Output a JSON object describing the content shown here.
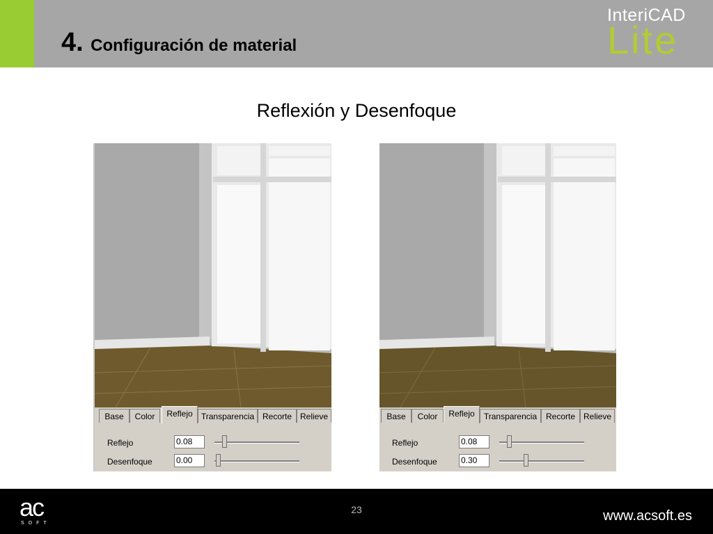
{
  "header": {
    "number": "4.",
    "title": "Configuración de material",
    "logo_top": "InteriCAD",
    "logo_bottom": "Lite",
    "accent_color": "#99cc33",
    "bar_color": "#a6a6a6"
  },
  "subtitle": "Reflexión y Desenfoque",
  "panels": [
    {
      "tabs": [
        "Base",
        "Color",
        "Reflejo",
        "Transparencia",
        "Recorte",
        "Relieve"
      ],
      "active_tab": "Reflejo",
      "reflejo_label": "Reflejo",
      "reflejo_value": "0.08",
      "desenfoque_label": "Desenfoque",
      "desenfoque_value": "0.00"
    },
    {
      "tabs": [
        "Base",
        "Color",
        "Reflejo",
        "Transparencia",
        "Recorte",
        "Relieve"
      ],
      "active_tab": "Reflejo",
      "reflejo_label": "Reflejo",
      "reflejo_value": "0.08",
      "desenfoque_label": "Desenfoque",
      "desenfoque_value": "0.30"
    }
  ],
  "footer": {
    "logo_letters": "ac",
    "logo_sub": "SOFT",
    "page_number": "23",
    "website": "www.acsoft.es"
  }
}
